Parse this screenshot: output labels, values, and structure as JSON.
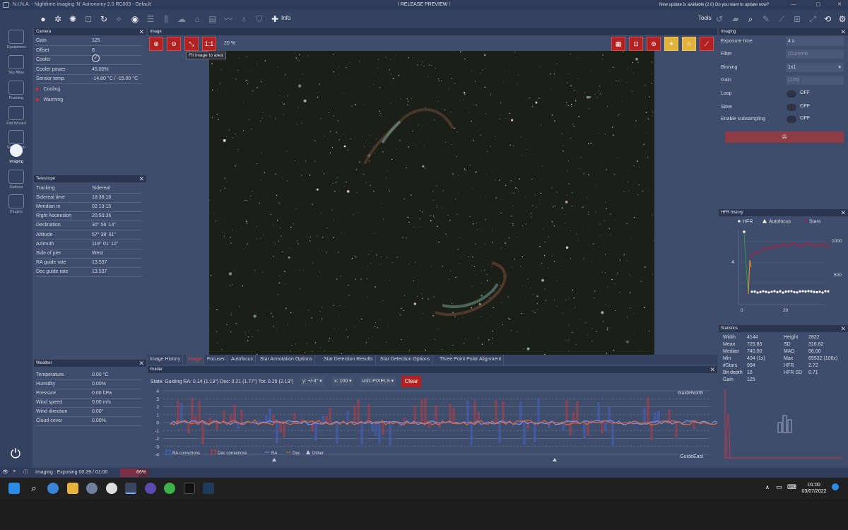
{
  "titlebar": {
    "app_title": "N.I.N.A. - Nighttime Imaging 'N' Astronomy 2.0 RC003 - Default",
    "center_text": "! RELEASE PREVIEW !",
    "update_text": "New update is available (2.0) Do you want to update now?"
  },
  "toolbar": {
    "info_label": "Info",
    "tools_label": "Tools"
  },
  "sidebar": {
    "items": [
      {
        "label": "Equipment"
      },
      {
        "label": "Sky Atlas"
      },
      {
        "label": "Framing"
      },
      {
        "label": "Flat Wizard"
      },
      {
        "label": "Sequencer"
      },
      {
        "label": "Imaging"
      },
      {
        "label": "Options"
      },
      {
        "label": "Plugins"
      }
    ]
  },
  "camera": {
    "title": "Camera",
    "rows": [
      {
        "label": "Gain",
        "value": "125"
      },
      {
        "label": "Offset",
        "value": "8"
      },
      {
        "label": "Cooler",
        "value": ""
      },
      {
        "label": "Cooler power",
        "value": "45.00%"
      },
      {
        "label": "Sensor temp.",
        "value": "-14.80 °C / -15.00 °C"
      }
    ],
    "expanders": [
      "Cooling",
      "Warming"
    ]
  },
  "telescope": {
    "title": "Telescope",
    "rows": [
      {
        "label": "Tracking",
        "value": "Sidereal"
      },
      {
        "label": "Sidereal time",
        "value": "18:38:18"
      },
      {
        "label": "Meridian in",
        "value": "02:13:15"
      },
      {
        "label": "Right Ascension",
        "value": "20:50:36"
      },
      {
        "label": "Declination",
        "value": "30° 56' 14\""
      },
      {
        "label": "Altitude",
        "value": "57° 38' 01\""
      },
      {
        "label": "Azimuth",
        "value": "119° 01' 12\""
      },
      {
        "label": "Side of pier",
        "value": "West"
      },
      {
        "label": "RA guide rate",
        "value": "13.537"
      },
      {
        "label": "Dec guide rate",
        "value": "13.537"
      }
    ]
  },
  "weather": {
    "title": "Weather",
    "rows": [
      {
        "label": "Temperature",
        "value": "0.00 °C"
      },
      {
        "label": "Humidity",
        "value": "0.00%"
      },
      {
        "label": "Pressure",
        "value": "0.00 hPa"
      },
      {
        "label": "Wind speed",
        "value": "0.00 m/s"
      },
      {
        "label": "Wind direction",
        "value": "0.00°"
      },
      {
        "label": "Cloud cover",
        "value": "0.00%"
      }
    ]
  },
  "image": {
    "title": "Image",
    "zoom": "20 %",
    "tooltip": "Fit image to area",
    "one_to_one": "1:1"
  },
  "tabs": [
    "Image History",
    "Image",
    "Focuser",
    "Autofocus",
    "Star Annotation Options",
    "Star Detection Results",
    "Star Detection Options",
    "Three Point Polar Alignment"
  ],
  "guider": {
    "title": "Guider",
    "state": "State: Guiding  RA: 0.14 (1.19\")  Dec: 0.21 (1.77\")  Tot: 0.25 (2.13\")",
    "y_scale": "y: +/-4\"",
    "x_scale": "x: 100",
    "unit": "unit: PIXELS",
    "clear_label": "Clear",
    "north_label": "GuideNorth",
    "east_label": "GuideEast",
    "y_ticks": [
      "4",
      "3",
      "2",
      "1",
      "0",
      "-1",
      "-2",
      "-3",
      "-4"
    ],
    "legend": [
      "RA corrections",
      "Dec corrections",
      "RA",
      "Dec",
      "Dither"
    ],
    "colors": {
      "ra": "#4a63d6",
      "dec": "#d23a3a",
      "dither": "#c8cde0"
    }
  },
  "imaging": {
    "title": "Imaging",
    "exposure_label": "Exposure time",
    "exposure_value": "4",
    "exposure_unit": "s",
    "filter_label": "Filter",
    "filter_value": "(Current)",
    "binning_label": "Binning",
    "binning_value": "1x1",
    "gain_label": "Gain",
    "gain_value": "(125)",
    "loop_label": "Loop",
    "save_label": "Save",
    "subsampling_label": "Enable subsampling",
    "off": "OFF"
  },
  "hfr": {
    "title": "HFR history",
    "legend": [
      "HFR",
      "Autofocus",
      "Stars"
    ],
    "y_left": "4",
    "y_right": [
      "1000",
      "500"
    ],
    "x_ticks": [
      "0",
      "20"
    ]
  },
  "statistics": {
    "title": "Statistics",
    "left": [
      {
        "label": "Width",
        "value": "4144"
      },
      {
        "label": "Mean",
        "value": "725.85"
      },
      {
        "label": "Median",
        "value": "740.00"
      },
      {
        "label": "Min",
        "value": "404 (1x)"
      },
      {
        "label": "#Stars",
        "value": "994"
      },
      {
        "label": "Bit depth",
        "value": "16"
      },
      {
        "label": "Gain",
        "value": "125"
      }
    ],
    "right": [
      {
        "label": "Height",
        "value": "2822"
      },
      {
        "label": "SD",
        "value": "316.62"
      },
      {
        "label": "MAD",
        "value": "56.00"
      },
      {
        "label": "Max",
        "value": "65532 (106x)"
      },
      {
        "label": "HFR",
        "value": "2.72"
      },
      {
        "label": "HFR SD",
        "value": "0.71"
      }
    ]
  },
  "status": {
    "imaging_text": "Imaging :   Exposing 00:39 / 01:00",
    "progress_text": "66%",
    "progress": 0.66
  },
  "taskbar": {
    "time": "01:00",
    "date": "03/07/2022"
  }
}
